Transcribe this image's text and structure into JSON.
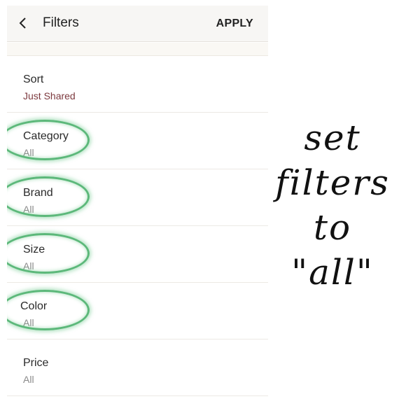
{
  "header": {
    "back_icon": "chevron-left-icon",
    "title": "Filters",
    "apply_label": "APPLY"
  },
  "filters": [
    {
      "label": "Sort",
      "value": "Just Shared"
    },
    {
      "label": "Category",
      "value": "All"
    },
    {
      "label": "Brand",
      "value": "All"
    },
    {
      "label": "Size",
      "value": "All"
    },
    {
      "label": "Color",
      "value": "All"
    },
    {
      "label": "Price",
      "value": "All"
    }
  ],
  "annotation": {
    "lines": [
      "set",
      "filters",
      "to",
      "\"all\""
    ],
    "ring_color": "#5cb87a"
  },
  "colors": {
    "sort_value": "#7d3a3f",
    "muted_value": "#8a8a8a"
  }
}
